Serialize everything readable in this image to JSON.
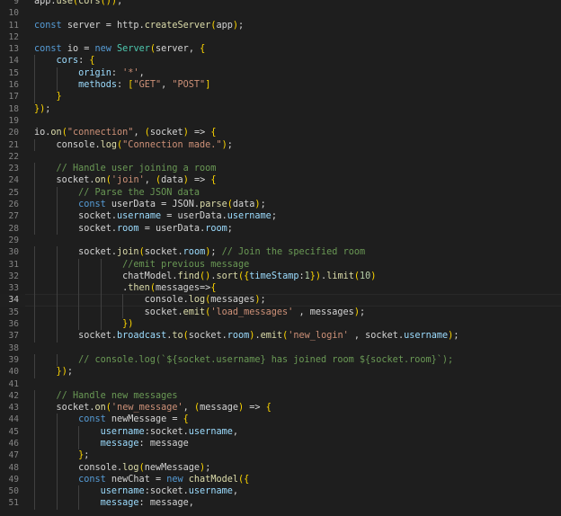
{
  "editor": {
    "language": "javascript",
    "theme_colors": {
      "background": "#1e1e1e",
      "keyword": "#569cd6",
      "function": "#dcdcaa",
      "property": "#9cdcfe",
      "string": "#ce9178",
      "comment": "#6a9955",
      "number": "#b5cea8",
      "class": "#4ec9b0",
      "line_number": "#858585"
    },
    "current_line": 34,
    "line_numbers": [
      "9",
      "10",
      "11",
      "12",
      "13",
      "14",
      "15",
      "16",
      "17",
      "18",
      "19",
      "20",
      "21",
      "22",
      "23",
      "24",
      "25",
      "26",
      "27",
      "28",
      "29",
      "30",
      "31",
      "32",
      "33",
      "34",
      "35",
      "36",
      "37",
      "38",
      "39",
      "40",
      "41",
      "42",
      "43",
      "44",
      "45",
      "46",
      "47",
      "48",
      "49",
      "50",
      "51"
    ],
    "lines": [
      "app.use(cors());",
      "",
      "const server = http.createServer(app);",
      "",
      "const io = new Server(server, {",
      "    cors: {",
      "        origin: '*',",
      "        methods: [\"GET\", \"POST\"]",
      "    }",
      "});",
      "",
      "io.on(\"connection\", (socket) => {",
      "    console.log(\"Connection made.\");",
      "",
      "    // Handle user joining a room",
      "    socket.on('join', (data) => {",
      "        // Parse the JSON data",
      "        const userData = JSON.parse(data);",
      "        socket.username = userData.username;",
      "        socket.room = userData.room;",
      "",
      "        socket.join(socket.room); // Join the specified room",
      "                //emit previous message",
      "                chatModel.find().sort({timeStamp:1}).limit(10)",
      "                .then(messages=>{",
      "                    console.log(messages);",
      "                    socket.emit('load_messages' , messages);",
      "                })",
      "        socket.broadcast.to(socket.room).emit('new_login' , socket.username);",
      "",
      "        // console.log(`${socket.username} has joined room ${socket.room}`);",
      "    });",
      "",
      "    // Handle new messages",
      "    socket.on('new_message', (message) => {",
      "        const newMessage = {",
      "            username:socket.username,",
      "            message: message",
      "        };",
      "        console.log(newMessage);",
      "        const newChat = new chatModel({",
      "            username:socket.username,",
      "            message: message,"
    ]
  }
}
